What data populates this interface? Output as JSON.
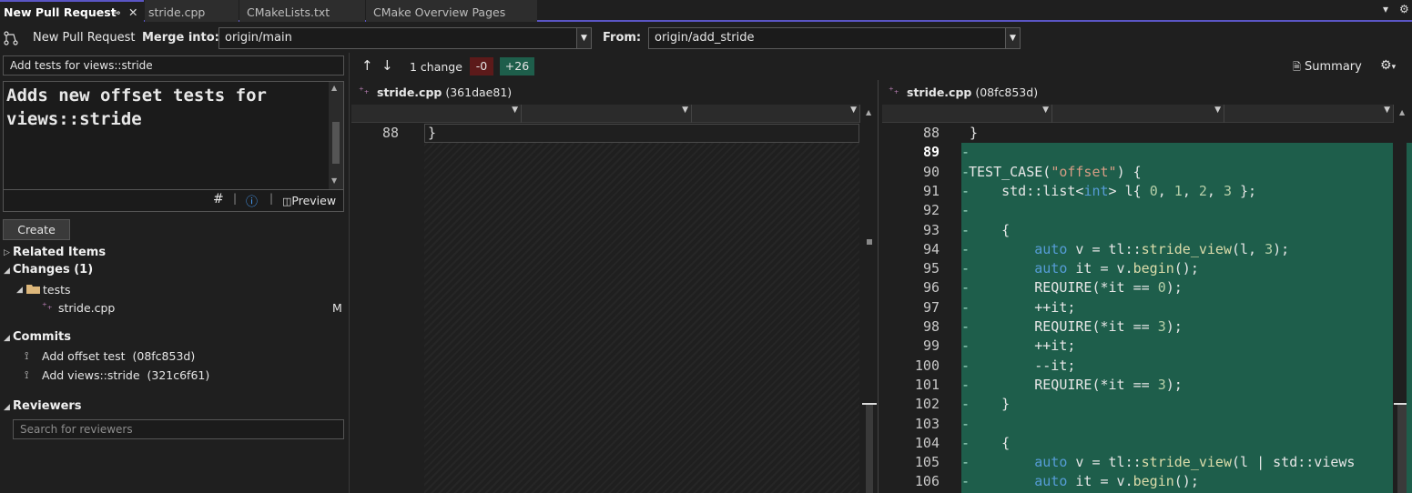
{
  "tabs": [
    {
      "label": "New Pull Request",
      "active": true
    },
    {
      "label": "stride.cpp"
    },
    {
      "label": "CMakeLists.txt"
    },
    {
      "label": "CMake Overview Pages"
    }
  ],
  "tab_pin": "⊸",
  "tab_close": "✕",
  "tab_menu": "▾",
  "toolbar": {
    "title": "New Pull Request",
    "merge_label": "Merge into:",
    "merge_value": "origin/main",
    "from_label": "From:",
    "from_value": "origin/add_stride"
  },
  "left": {
    "title_value": "Add tests for views::stride",
    "description": "Adds new offset tests for views::stride",
    "desc_tools": {
      "hash": "#",
      "info": "ⓘ",
      "preview": "Preview"
    },
    "create_label": "Create",
    "related_label": "Related Items",
    "changes_label": "Changes (1)",
    "folder": "tests",
    "file": "stride.cpp",
    "file_status": "M",
    "commits_label": "Commits",
    "commits": [
      {
        "msg": "Add offset test",
        "hash": "(08fc853d)"
      },
      {
        "msg": "Add views::stride",
        "hash": "(321c6f61)"
      }
    ],
    "reviewers_label": "Reviewers",
    "reviewers_placeholder": "Search for reviewers"
  },
  "diff": {
    "changes": "1 change",
    "removed": "-0",
    "added": "+26",
    "summary": "Summary",
    "left_file": "stride.cpp",
    "left_hash": "(361dae81)",
    "right_file": "stride.cpp",
    "right_hash": "(08fc853d)",
    "left_lines": [
      {
        "n": "88",
        "t": "}"
      }
    ],
    "right_lines": [
      {
        "n": "88",
        "t": "}"
      },
      {
        "n": "89",
        "t": ""
      },
      {
        "n": "90",
        "t": "TEST_CASE(\"offset\") {"
      },
      {
        "n": "91",
        "t": "    std::list<int> l{ 0, 1, 2, 3 };"
      },
      {
        "n": "92",
        "t": ""
      },
      {
        "n": "93",
        "t": "    {"
      },
      {
        "n": "94",
        "t": "        auto v = tl::stride_view(l, 3);"
      },
      {
        "n": "95",
        "t": "        auto it = v.begin();"
      },
      {
        "n": "96",
        "t": "        REQUIRE(*it == 0);"
      },
      {
        "n": "97",
        "t": "        ++it;"
      },
      {
        "n": "98",
        "t": "        REQUIRE(*it == 3);"
      },
      {
        "n": "99",
        "t": "        ++it;"
      },
      {
        "n": "100",
        "t": "        --it;"
      },
      {
        "n": "101",
        "t": "        REQUIRE(*it == 3);"
      },
      {
        "n": "102",
        "t": "    }"
      },
      {
        "n": "103",
        "t": ""
      },
      {
        "n": "104",
        "t": "    {"
      },
      {
        "n": "105",
        "t": "        auto v = tl::stride_view(l | std::views"
      },
      {
        "n": "106",
        "t": "        auto it = v.begin();"
      }
    ]
  },
  "colors": {
    "accent": "#5a55c4",
    "added_bg": "#1e5e4b",
    "removed_badge": "#5c1a1a",
    "added_badge": "#1e5e4b"
  }
}
